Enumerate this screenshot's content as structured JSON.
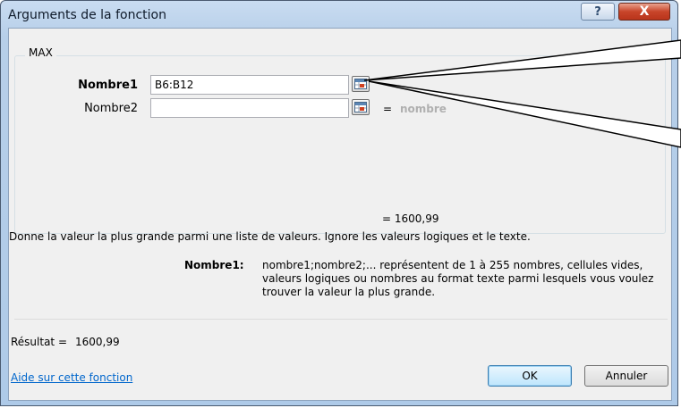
{
  "dialog": {
    "title": "Arguments de la fonction",
    "help_label": "?",
    "close_label": "X"
  },
  "function": {
    "name": "MAX",
    "args": [
      {
        "label": "Nombre1",
        "value": "B6:B12",
        "bold": true
      },
      {
        "label": "Nombre2",
        "value": "",
        "result": "nombre"
      }
    ],
    "computed": "= 1600,99",
    "description": "Donne la valeur la plus grande parmi une liste de valeurs. Ignore les valeurs logiques et le texte.",
    "arg_help_name": "Nombre1:",
    "arg_help_lines": [
      "nombre1;nombre2;... représentent de 1 à 255 nombres, cellules vides,",
      "valeurs logiques ou nombres au format texte parmi lesquels vous voulez",
      "trouver la valeur la plus grande."
    ]
  },
  "result": {
    "label": "Résultat =",
    "value": "1600,99"
  },
  "footer": {
    "help_link": "Aide sur cette fonction",
    "ok_label": "OK",
    "cancel_label": "Annuler"
  },
  "icons": {
    "ref_button": "range-select-icon",
    "help": "help-icon",
    "close": "close-icon"
  }
}
